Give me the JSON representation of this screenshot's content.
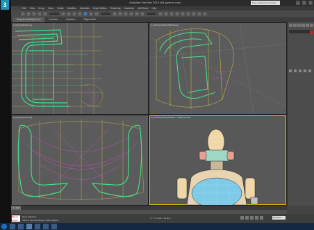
{
  "app": {
    "logo": "3",
    "title": "Autodesk 3ds Max 2015 x64    gumroo.max",
    "search_placeholder": "Type a keyword or phrase"
  },
  "menus": [
    "Edit",
    "Tools",
    "Group",
    "Views",
    "Create",
    "Modifiers",
    "Animation",
    "Graph Editors",
    "Rendering",
    "Customize",
    "MAXScript",
    "Help"
  ],
  "ribbon": {
    "tabs": [
      "Graphite Modeling Tools",
      "Freeform",
      "Selection",
      "Object Paint"
    ]
  },
  "viewports": {
    "top_left": "[+] [Top] [Wireframe]",
    "top_right": "[+] [Orthographic] [Wireframe]",
    "bottom_left": "[+] [Left] [Wireframe]",
    "bottom_right": "[+] [Orthographic] [Shaded + Edged Faces]"
  },
  "timeline": {
    "slider": "0 / 100"
  },
  "status": {
    "maxscript_label": "Max to Physc",
    "msg1": "None Selected",
    "msg2": "Click or click-and-drag to select objects",
    "coords": "X:   Y:   Z:   Grid = 10.0cm",
    "autokey": "Selected"
  },
  "colors": {
    "wire_green": "#3fe08a",
    "wire_yellow": "#d8c848",
    "wire_magenta": "#d84cd0",
    "viewport_bg": "#5b5b5b",
    "accent": "#1f8fb8"
  }
}
